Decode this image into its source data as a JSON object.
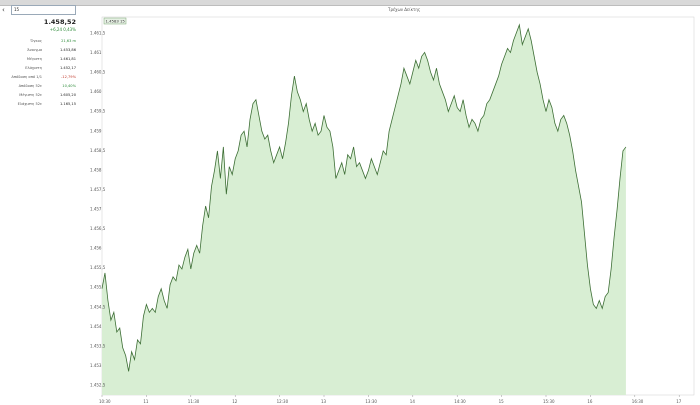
{
  "header": {
    "subtitle": "Τρέχων Δείκτης"
  },
  "search": {
    "value": "15"
  },
  "quote": {
    "price": "1.458,52",
    "change": "+6,24  0,43%",
    "stats": [
      {
        "label": "Όγκος",
        "value": "21,63 m",
        "tone": "green"
      },
      {
        "label": "Άνοιγμα",
        "value": "1.453,86",
        "tone": "normal"
      },
      {
        "label": "Μέγιστη",
        "value": "1.461,81",
        "tone": "normal"
      },
      {
        "label": "Ελάχιστη",
        "value": "1.452,17",
        "tone": "normal"
      },
      {
        "label": "Απόδοση από 1/1",
        "value": "-12,79%",
        "tone": "red"
      },
      {
        "label": "Απόδοση 52ε",
        "value": "10,40%",
        "tone": "green"
      },
      {
        "label": "Μέγιστη 52ε",
        "value": "1.605,20",
        "tone": "normal"
      },
      {
        "label": "Ελάχιστη 52ε",
        "value": "1.165,15",
        "tone": "normal"
      }
    ]
  },
  "colors": {
    "line": "#3d6e35",
    "fill": "#d8eed3",
    "green": "#2e8b3a",
    "red": "#c0392b"
  },
  "chart_data": {
    "type": "area",
    "tag_value": "1.4583 15",
    "y_ticks": [
      "1.461,5",
      "1.461",
      "1.460,5",
      "1.460",
      "1.459,5",
      "1.459",
      "1.458,5",
      "1.458",
      "1.457,5",
      "1.457",
      "1.456,5",
      "1.456",
      "1.455,5",
      "1.455",
      "1.454,5",
      "1.454",
      "1.453,5",
      "1.453",
      "1.452,5"
    ],
    "x_ticks": [
      {
        "label": "10:30",
        "t": 0
      },
      {
        "label": "11",
        "t": 30
      },
      {
        "label": "11:30",
        "t": 60
      },
      {
        "label": "12",
        "t": 90
      },
      {
        "label": "12:30",
        "t": 120
      },
      {
        "label": "13",
        "t": 150
      },
      {
        "label": "13:30",
        "t": 180
      },
      {
        "label": "14",
        "t": 210
      },
      {
        "label": "14:30",
        "t": 240
      },
      {
        "label": "15",
        "t": 270
      },
      {
        "label": "15:30",
        "t": 300
      },
      {
        "label": "16",
        "t": 330
      },
      {
        "label": "16:30",
        "t": 360
      },
      {
        "label": "17",
        "t": 390
      }
    ],
    "ylim": [
      1452.3,
      1461.9
    ],
    "xlim": [
      0,
      400
    ],
    "points": [
      [
        0,
        1455.0
      ],
      [
        2,
        1455.4
      ],
      [
        4,
        1454.7
      ],
      [
        6,
        1454.2
      ],
      [
        8,
        1454.4
      ],
      [
        10,
        1453.9
      ],
      [
        12,
        1454.0
      ],
      [
        14,
        1453.5
      ],
      [
        16,
        1453.3
      ],
      [
        18,
        1452.9
      ],
      [
        20,
        1453.4
      ],
      [
        22,
        1453.2
      ],
      [
        24,
        1453.7
      ],
      [
        26,
        1453.6
      ],
      [
        28,
        1454.3
      ],
      [
        30,
        1454.6
      ],
      [
        32,
        1454.4
      ],
      [
        34,
        1454.5
      ],
      [
        36,
        1454.4
      ],
      [
        38,
        1454.8
      ],
      [
        40,
        1455.0
      ],
      [
        42,
        1454.7
      ],
      [
        44,
        1454.5
      ],
      [
        46,
        1455.1
      ],
      [
        48,
        1455.3
      ],
      [
        50,
        1455.2
      ],
      [
        52,
        1455.6
      ],
      [
        54,
        1455.5
      ],
      [
        56,
        1455.8
      ],
      [
        58,
        1456.0
      ],
      [
        60,
        1455.5
      ],
      [
        62,
        1455.9
      ],
      [
        64,
        1456.1
      ],
      [
        66,
        1455.9
      ],
      [
        68,
        1456.6
      ],
      [
        70,
        1457.1
      ],
      [
        72,
        1456.8
      ],
      [
        74,
        1457.6
      ],
      [
        76,
        1458.0
      ],
      [
        78,
        1458.5
      ],
      [
        80,
        1457.8
      ],
      [
        82,
        1458.6
      ],
      [
        84,
        1457.4
      ],
      [
        86,
        1458.1
      ],
      [
        88,
        1457.9
      ],
      [
        90,
        1458.3
      ],
      [
        92,
        1458.5
      ],
      [
        94,
        1458.9
      ],
      [
        96,
        1459.0
      ],
      [
        98,
        1458.6
      ],
      [
        100,
        1459.3
      ],
      [
        102,
        1459.7
      ],
      [
        104,
        1459.8
      ],
      [
        106,
        1459.4
      ],
      [
        108,
        1459.0
      ],
      [
        110,
        1458.8
      ],
      [
        112,
        1458.9
      ],
      [
        114,
        1458.5
      ],
      [
        116,
        1458.2
      ],
      [
        118,
        1458.4
      ],
      [
        120,
        1458.6
      ],
      [
        122,
        1458.3
      ],
      [
        124,
        1458.7
      ],
      [
        126,
        1459.2
      ],
      [
        128,
        1459.9
      ],
      [
        130,
        1460.4
      ],
      [
        132,
        1460.0
      ],
      [
        134,
        1459.8
      ],
      [
        136,
        1459.5
      ],
      [
        138,
        1459.7
      ],
      [
        140,
        1459.3
      ],
      [
        142,
        1459.0
      ],
      [
        144,
        1459.2
      ],
      [
        146,
        1458.9
      ],
      [
        148,
        1459.0
      ],
      [
        150,
        1459.4
      ],
      [
        152,
        1459.1
      ],
      [
        154,
        1459.0
      ],
      [
        156,
        1458.6
      ],
      [
        158,
        1457.8
      ],
      [
        160,
        1458.0
      ],
      [
        162,
        1458.2
      ],
      [
        164,
        1457.9
      ],
      [
        166,
        1458.4
      ],
      [
        168,
        1458.3
      ],
      [
        170,
        1458.6
      ],
      [
        172,
        1458.1
      ],
      [
        174,
        1458.2
      ],
      [
        176,
        1458.0
      ],
      [
        178,
        1457.8
      ],
      [
        180,
        1458.0
      ],
      [
        182,
        1458.3
      ],
      [
        184,
        1458.1
      ],
      [
        186,
        1457.9
      ],
      [
        188,
        1458.2
      ],
      [
        190,
        1458.5
      ],
      [
        192,
        1458.4
      ],
      [
        194,
        1459.0
      ],
      [
        196,
        1459.3
      ],
      [
        198,
        1459.6
      ],
      [
        200,
        1459.9
      ],
      [
        202,
        1460.2
      ],
      [
        204,
        1460.6
      ],
      [
        206,
        1460.4
      ],
      [
        208,
        1460.2
      ],
      [
        210,
        1460.5
      ],
      [
        212,
        1460.8
      ],
      [
        214,
        1460.6
      ],
      [
        216,
        1460.9
      ],
      [
        218,
        1461.0
      ],
      [
        220,
        1460.8
      ],
      [
        222,
        1460.5
      ],
      [
        224,
        1460.3
      ],
      [
        226,
        1460.6
      ],
      [
        228,
        1460.2
      ],
      [
        230,
        1460.0
      ],
      [
        232,
        1459.8
      ],
      [
        234,
        1459.5
      ],
      [
        236,
        1459.7
      ],
      [
        238,
        1459.9
      ],
      [
        240,
        1459.6
      ],
      [
        242,
        1459.5
      ],
      [
        244,
        1459.8
      ],
      [
        246,
        1459.4
      ],
      [
        248,
        1459.1
      ],
      [
        250,
        1459.3
      ],
      [
        252,
        1459.2
      ],
      [
        254,
        1459.0
      ],
      [
        256,
        1459.3
      ],
      [
        258,
        1459.4
      ],
      [
        260,
        1459.7
      ],
      [
        262,
        1459.8
      ],
      [
        264,
        1460.0
      ],
      [
        266,
        1460.2
      ],
      [
        268,
        1460.4
      ],
      [
        270,
        1460.7
      ],
      [
        272,
        1460.9
      ],
      [
        274,
        1461.1
      ],
      [
        276,
        1461.0
      ],
      [
        278,
        1461.3
      ],
      [
        280,
        1461.5
      ],
      [
        282,
        1461.7
      ],
      [
        284,
        1461.2
      ],
      [
        286,
        1461.4
      ],
      [
        288,
        1461.6
      ],
      [
        290,
        1461.3
      ],
      [
        292,
        1460.9
      ],
      [
        294,
        1460.5
      ],
      [
        296,
        1460.2
      ],
      [
        298,
        1459.8
      ],
      [
        300,
        1459.5
      ],
      [
        302,
        1459.8
      ],
      [
        304,
        1459.6
      ],
      [
        306,
        1459.2
      ],
      [
        308,
        1459.0
      ],
      [
        310,
        1459.3
      ],
      [
        312,
        1459.4
      ],
      [
        314,
        1459.2
      ],
      [
        316,
        1458.9
      ],
      [
        318,
        1458.5
      ],
      [
        320,
        1458.0
      ],
      [
        322,
        1457.6
      ],
      [
        324,
        1457.2
      ],
      [
        326,
        1456.4
      ],
      [
        328,
        1455.6
      ],
      [
        330,
        1455.0
      ],
      [
        332,
        1454.6
      ],
      [
        334,
        1454.5
      ],
      [
        336,
        1454.7
      ],
      [
        338,
        1454.5
      ],
      [
        340,
        1454.8
      ],
      [
        342,
        1454.9
      ],
      [
        344,
        1455.5
      ],
      [
        346,
        1456.3
      ],
      [
        348,
        1457.0
      ],
      [
        350,
        1457.8
      ],
      [
        352,
        1458.5
      ],
      [
        354,
        1458.6
      ]
    ]
  }
}
